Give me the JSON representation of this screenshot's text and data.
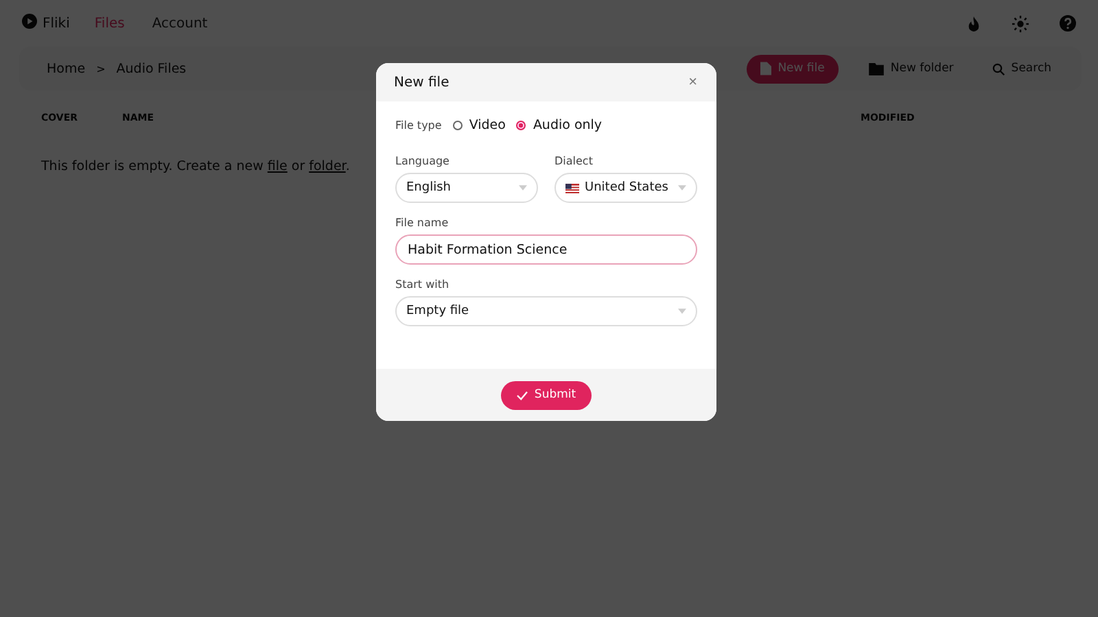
{
  "nav": {
    "brand": "Fliki",
    "tabs": [
      {
        "label": "Files",
        "selected": true
      },
      {
        "label": "Account",
        "selected": false
      }
    ]
  },
  "toolbar": {
    "breadcrumb": [
      "Home",
      "Audio Files"
    ],
    "breadcrumb_separator": ">",
    "new_file": "New file",
    "new_folder": "New folder",
    "search": "Search"
  },
  "table": {
    "columns": [
      "COVER",
      "NAME",
      "MODIFIED"
    ]
  },
  "empty_message": [
    {
      "kind": "text",
      "text": "This folder is empty. Create a new "
    },
    {
      "kind": "link",
      "text": "file"
    },
    {
      "kind": "text",
      "text": " or "
    },
    {
      "kind": "link",
      "text": "folder"
    },
    {
      "kind": "text",
      "text": "."
    }
  ],
  "dialog": {
    "title": "New file",
    "close": "×",
    "file_type": {
      "label": "File type",
      "options": [
        {
          "label": "Video",
          "selected": false
        },
        {
          "label": "Audio only",
          "selected": true
        }
      ]
    },
    "language": {
      "label": "Language",
      "value": "English"
    },
    "dialect": {
      "label": "Dialect",
      "value": "United States"
    },
    "file_name": {
      "label": "File name",
      "value": "Habit Formation Science"
    },
    "start_with": {
      "label": "Start with",
      "value": "Empty file"
    },
    "submit": "Submit"
  }
}
